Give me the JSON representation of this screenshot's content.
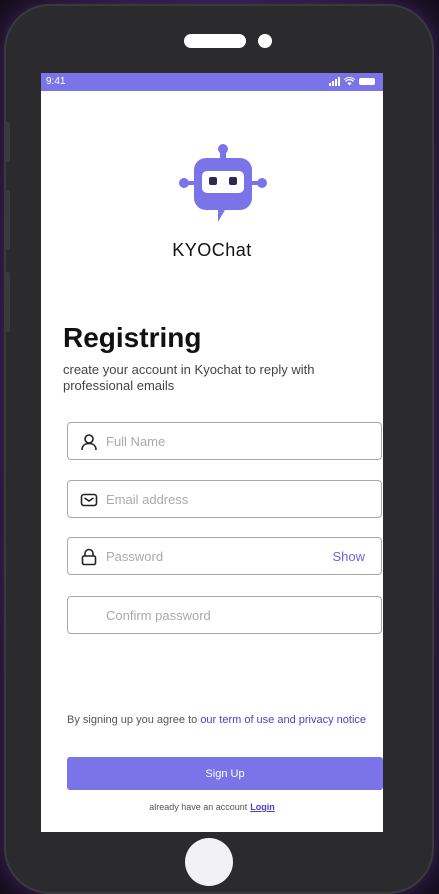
{
  "status_bar": {
    "time": "9:41"
  },
  "app": {
    "name": "KYOChat"
  },
  "register": {
    "title": "Registring",
    "subtitle": "create your account in Kyochat to reply with professional emails"
  },
  "form": {
    "full_name": {
      "placeholder": "Full Name",
      "value": ""
    },
    "email": {
      "placeholder": "Email address",
      "value": ""
    },
    "password": {
      "placeholder": "Password",
      "value": "",
      "show_label": "Show"
    },
    "confirm_password": {
      "placeholder": "Confirm password",
      "value": ""
    }
  },
  "terms": {
    "prefix": "By signing up you agree to ",
    "terms_link": "our term of use",
    "and_word": "and",
    "privacy_link": "privacy notice"
  },
  "signup": {
    "label": "Sign Up"
  },
  "login_prompt": {
    "text": "already have an account",
    "link": "Login"
  },
  "colors": {
    "accent": "#7b74e8",
    "link": "#4a41c9"
  },
  "icons": {
    "logo": "robot-chat-logo-icon",
    "full_name": "user-icon",
    "email": "mail-icon",
    "password": "lock-icon"
  }
}
